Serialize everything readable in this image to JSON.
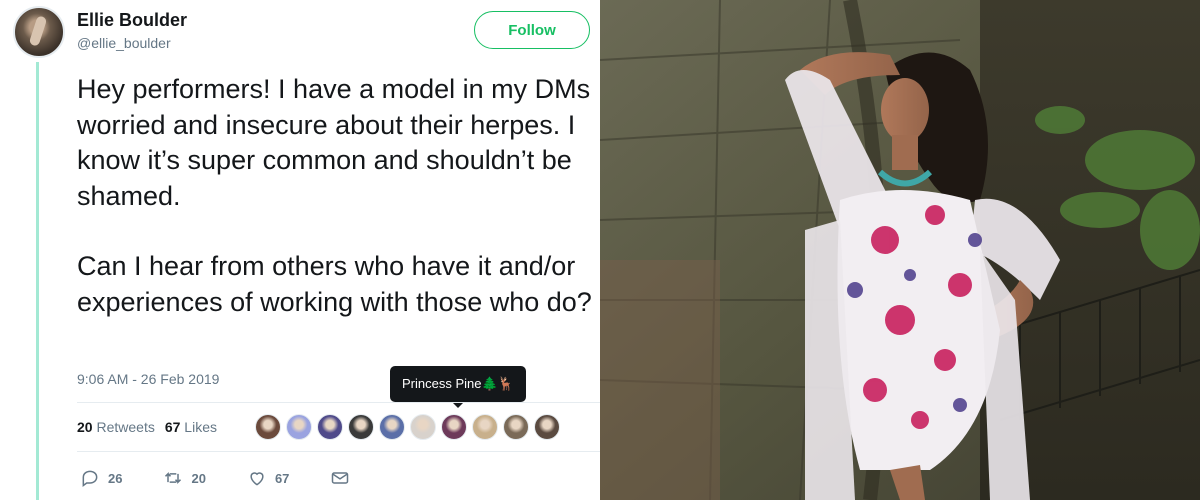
{
  "tweet": {
    "display_name": "Ellie Boulder",
    "handle": "@ellie_boulder",
    "follow_label": "Follow",
    "text_paragraphs": [
      "Hey performers! I have a model in my DMs worried and insecure about their herpes. I know it’s super common and shouldn’t be shamed.",
      "Can I hear from others who have it and/or experiences of working with those who do?"
    ],
    "timestamp": "9:06 AM - 26 Feb 2019",
    "tooltip": "Princess Pine🌲🦌",
    "stats": {
      "retweets_count": "20",
      "retweets_label": "Retweets",
      "likes_count": "67",
      "likes_label": "Likes"
    },
    "liker_colors": [
      "#6b4a3c",
      "#9aa3e0",
      "#4f4a8a",
      "#3a3a3a",
      "#5b6fa8",
      "#d8d2cc",
      "#6d3a5a",
      "#c8b08c",
      "#7a6a58",
      "#5a4a40"
    ],
    "actions": {
      "reply_count": "26",
      "retweet_count": "20",
      "like_count": "67"
    },
    "accent_color": "#17bf63",
    "thread_line_color": "#a3e9d4"
  },
  "photo": {
    "subject": "woman in floral dress posing in front of stone tunnel wall"
  }
}
